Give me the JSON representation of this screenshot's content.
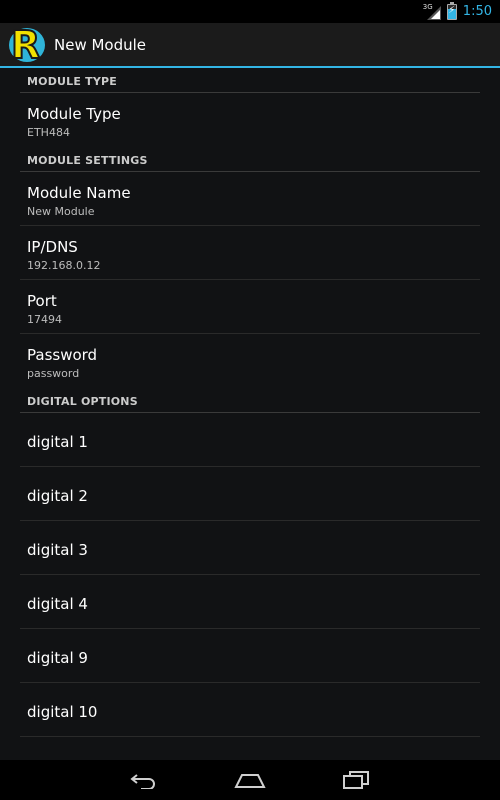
{
  "status": {
    "network": "3G",
    "time": "1:50"
  },
  "action_bar": {
    "logo_letter": "R",
    "title": "New Module"
  },
  "sections": {
    "module_type": {
      "header": "MODULE TYPE",
      "items": [
        {
          "title": "Module Type",
          "summary": "ETH484"
        }
      ]
    },
    "module_settings": {
      "header": "MODULE SETTINGS",
      "items": [
        {
          "title": "Module Name",
          "summary": "New Module"
        },
        {
          "title": "IP/DNS",
          "summary": "192.168.0.12"
        },
        {
          "title": "Port",
          "summary": "17494"
        },
        {
          "title": "Password",
          "summary": "password"
        }
      ]
    },
    "digital_options": {
      "header": "DIGITAL OPTIONS",
      "items": [
        "digital 1",
        "digital 2",
        "digital 3",
        "digital 4",
        "digital 9",
        "digital 10"
      ]
    }
  },
  "navigation": {
    "back": "back-icon",
    "home": "home-icon",
    "recents": "recents-icon"
  },
  "colors": {
    "accent": "#33b5e5",
    "background": "#111214",
    "logo_yellow": "#f2e100"
  }
}
